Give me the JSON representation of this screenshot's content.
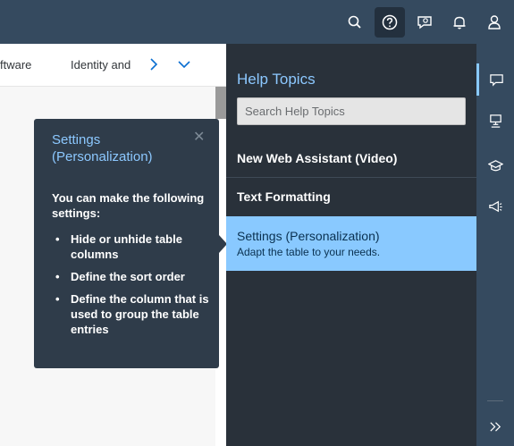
{
  "shellbar": {
    "icons": [
      "search-icon",
      "help-icon",
      "feedback-icon",
      "notifications-icon",
      "user-icon"
    ],
    "active_icon": "help-icon"
  },
  "tabs": {
    "left_text": "ftware",
    "second_text": "Identity and",
    "next_icon": "chevron-right-icon",
    "more_icon": "chevron-down-icon"
  },
  "callout": {
    "title": "Settings (Personalization)",
    "close_icon": "close-icon",
    "intro": "You can make the following settings:",
    "items": [
      "Hide or unhide table columns",
      "Define the sort order",
      "Define the column that is used to group the table entries"
    ]
  },
  "help_panel": {
    "title": "Help Topics",
    "search_placeholder": "Search Help Topics",
    "topics": [
      {
        "label": "New Web Assistant (Video)"
      },
      {
        "label": "Text Formatting"
      },
      {
        "label": "Settings (Personalization)",
        "description": "Adapt the table to your needs.",
        "selected": true
      }
    ]
  },
  "rail": {
    "icons": [
      "help-topics-icon",
      "guided-tours-icon",
      "learning-icon",
      "whats-new-icon",
      "collapse-icon"
    ],
    "active_icon": "help-topics-icon"
  },
  "colors": {
    "shell": "#354a5f",
    "panel": "#29313a",
    "accent": "#8cc8ff",
    "selected": "#89c9ff",
    "callout": "#2f3c4a"
  }
}
